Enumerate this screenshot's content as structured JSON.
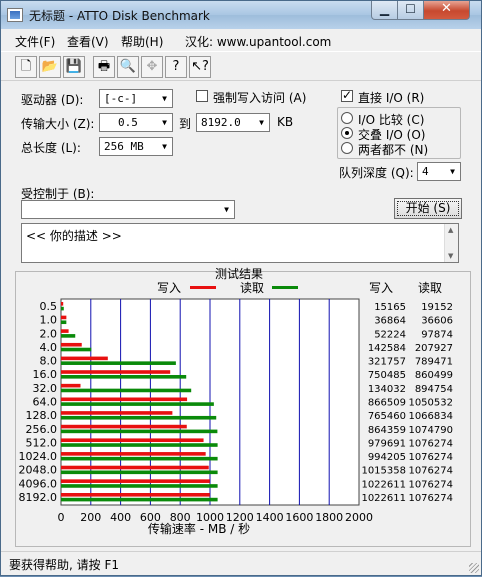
{
  "window": {
    "title": "无标题 - ATTO Disk Benchmark"
  },
  "menu": {
    "file": "文件(F)",
    "view": "查看(V)",
    "help": "帮助(H)",
    "credit": "汉化: www.upantool.com"
  },
  "toolbar": {
    "icons": [
      "new-icon",
      "open-icon",
      "save-icon",
      "print-icon",
      "print-preview-icon",
      "move-icon",
      "help-icon",
      "context-help-icon"
    ]
  },
  "controls": {
    "drive_label": "驱动器 (D):",
    "drive_value": "[-c-]",
    "transfer_label": "传输大小 (Z):",
    "transfer_from": "0.5",
    "to_label": "到",
    "transfer_to": "8192.0",
    "kb_label": "KB",
    "total_label": "总长度 (L):",
    "total_value": "256 MB",
    "force_write_label": "强制写入访问 (A)",
    "direct_io_label": "直接 I/O (R)",
    "io_compare_label": "I/O 比较 (C)",
    "io_overlap_label": "交叠 I/O (O)",
    "neither_label": "两者都不 (N)",
    "queue_label": "队列深度 (Q):",
    "queue_value": "4",
    "controlled_label": "受控制于 (B):",
    "controlled_value": "",
    "start_button": "开始 (S)",
    "description": "<<   你的描述    >>"
  },
  "chart_data": {
    "type": "bar",
    "orientation": "horizontal",
    "title": "测试结果",
    "xlabel": "传输速率 - MB / 秒",
    "xlim": [
      0,
      2000
    ],
    "xticks": [
      "0",
      "200",
      "400",
      "600",
      "800",
      "1000",
      "1200",
      "1400",
      "1600",
      "1800",
      "2000"
    ],
    "categories": [
      "0.5",
      "1.0",
      "2.0",
      "4.0",
      "8.0",
      "16.0",
      "32.0",
      "64.0",
      "128.0",
      "256.0",
      "512.0",
      "1024.0",
      "2048.0",
      "4096.0",
      "8192.0"
    ],
    "legend": {
      "write_label": "写入",
      "read_label": "读取"
    },
    "columns": {
      "write_header": "写入",
      "read_header": "读取"
    },
    "series": [
      {
        "name": "写入",
        "color": "#e81010",
        "values": [
          15165,
          36864,
          52224,
          142584,
          321757,
          750485,
          134032,
          866509,
          765460,
          864359,
          979691,
          994205,
          1015358,
          1022611,
          1022611
        ]
      },
      {
        "name": "读取",
        "color": "#0a8a0a",
        "values": [
          19152,
          36606,
          97874,
          207927,
          789471,
          860499,
          894754,
          1050532,
          1066834,
          1074790,
          1076274,
          1076274,
          1076274,
          1076274,
          1076274
        ]
      }
    ],
    "grid": true
  },
  "status": {
    "text": "要获得帮助, 请按 F1"
  }
}
